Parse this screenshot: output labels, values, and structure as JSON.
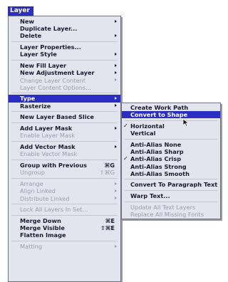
{
  "menubar": {
    "title": "Layer"
  },
  "menu": {
    "groups": [
      [
        {
          "label": "New",
          "submenu": true
        },
        {
          "label": "Duplicate Layer..."
        },
        {
          "label": "Delete",
          "submenu": true
        }
      ],
      [
        {
          "label": "Layer Properties..."
        },
        {
          "label": "Layer Style",
          "submenu": true
        }
      ],
      [
        {
          "label": "New Fill Layer",
          "submenu": true
        },
        {
          "label": "New Adjustment Layer",
          "submenu": true
        },
        {
          "label": "Change Layer Content",
          "submenu": true,
          "disabled": true
        },
        {
          "label": "Layer Content Options...",
          "disabled": true
        }
      ],
      [
        {
          "label": "Type",
          "submenu": true,
          "highlighted": true
        },
        {
          "label": "Rasterize",
          "submenu": true
        }
      ],
      [
        {
          "label": "New Layer Based Slice"
        }
      ],
      [
        {
          "label": "Add Layer Mask",
          "submenu": true
        },
        {
          "label": "Enable Layer Mask",
          "disabled": true
        }
      ],
      [
        {
          "label": "Add Vector Mask",
          "submenu": true
        },
        {
          "label": "Enable Vector Mask",
          "disabled": true
        }
      ],
      [
        {
          "label": "Group with Previous",
          "shortcut": "⌘G"
        },
        {
          "label": "Ungroup",
          "shortcut": "⇧⌘G",
          "disabled": true
        }
      ],
      [
        {
          "label": "Arrange",
          "submenu": true,
          "disabled": true
        },
        {
          "label": "Align Linked",
          "submenu": true,
          "disabled": true
        },
        {
          "label": "Distribute Linked",
          "submenu": true,
          "disabled": true
        }
      ],
      [
        {
          "label": "Lock All Layers In Set...",
          "disabled": true
        }
      ],
      [
        {
          "label": "Merge Down",
          "shortcut": "⌘E"
        },
        {
          "label": "Merge Visible",
          "shortcut": "⇧⌘E"
        },
        {
          "label": "Flatten Image"
        }
      ],
      [
        {
          "label": "Matting",
          "submenu": true,
          "disabled": true
        }
      ]
    ]
  },
  "submenu": {
    "groups": [
      [
        {
          "label": "Create Work Path"
        },
        {
          "label": "Convert to Shape",
          "highlighted": true
        }
      ],
      [
        {
          "label": "Horizontal",
          "checked": true
        },
        {
          "label": "Vertical"
        }
      ],
      [
        {
          "label": "Anti-Alias None"
        },
        {
          "label": "Anti-Alias Sharp"
        },
        {
          "label": "Anti-Alias Crisp",
          "checked": true
        },
        {
          "label": "Anti-Alias Strong"
        },
        {
          "label": "Anti-Alias Smooth"
        }
      ],
      [
        {
          "label": "Convert To Paragraph Text"
        }
      ],
      [
        {
          "label": "Warp Text..."
        }
      ],
      [
        {
          "label": "Update All Text Layers",
          "disabled": true
        },
        {
          "label": "Replace All Missing Fonts",
          "disabled": true
        }
      ]
    ],
    "check_mark": "✓"
  },
  "colors": {
    "highlight": "#2b2ec2",
    "menu_bg": "#e3e5ee",
    "disabled_text": "#9a9cad"
  }
}
